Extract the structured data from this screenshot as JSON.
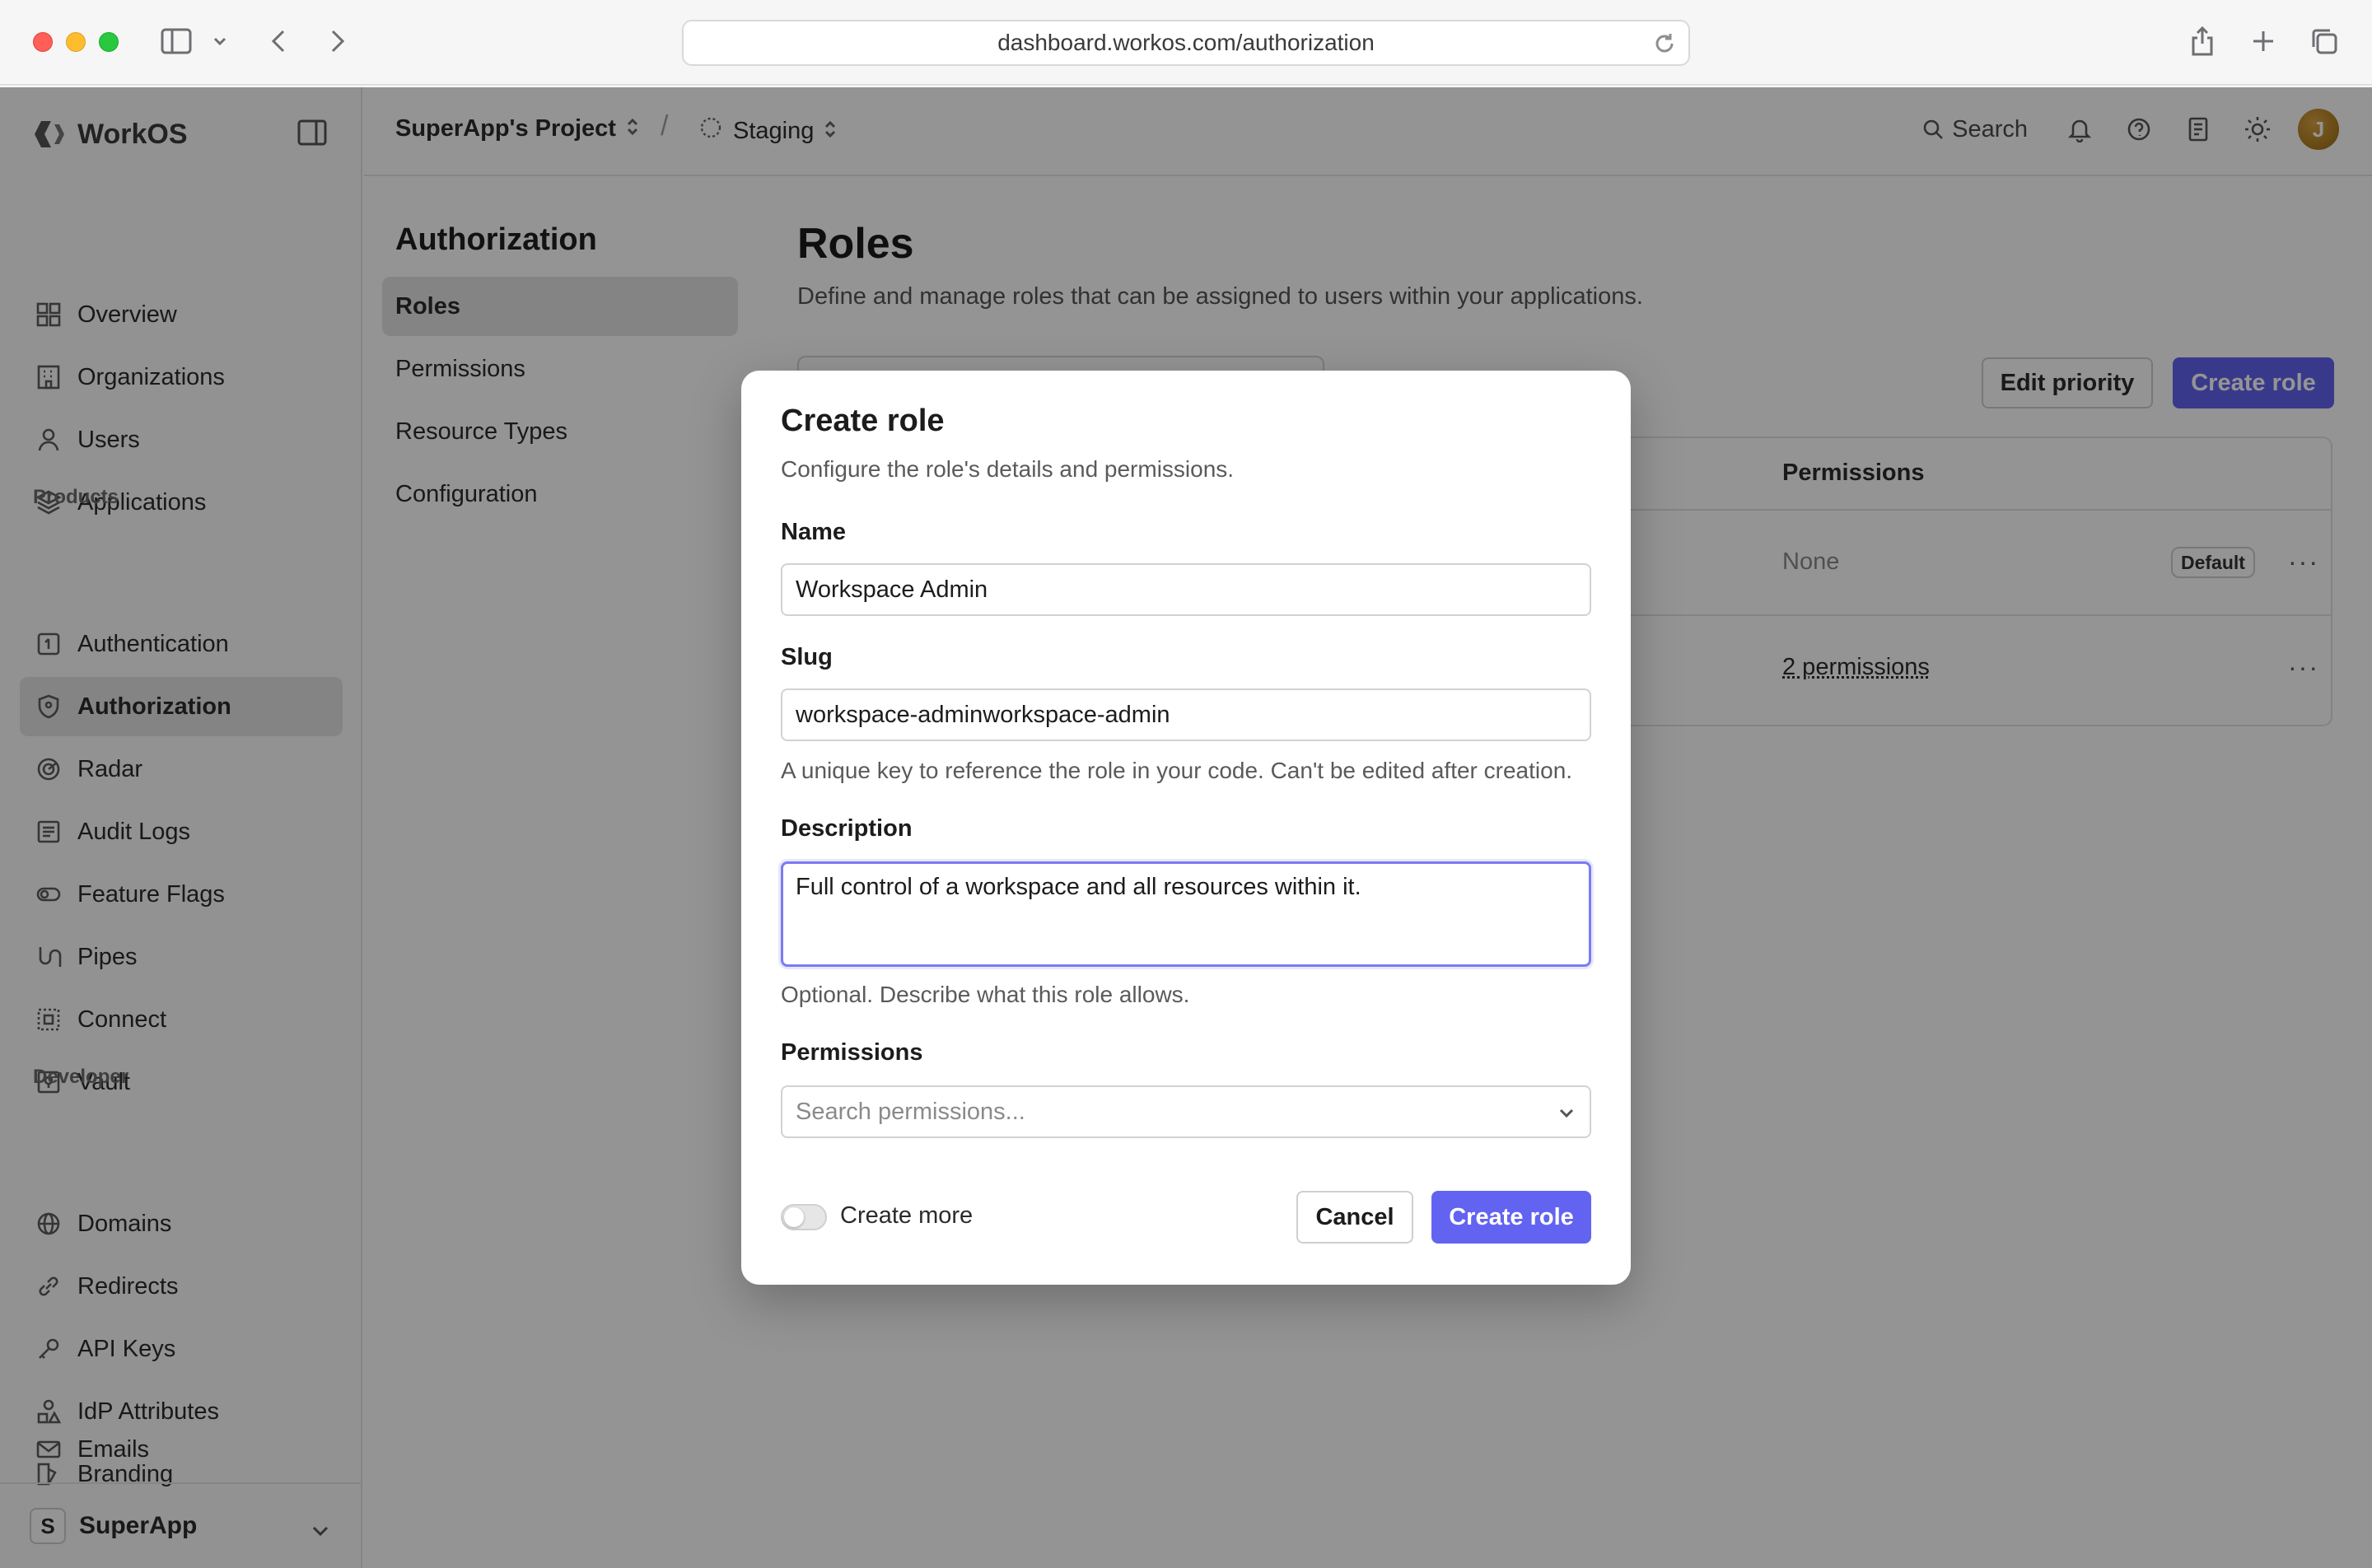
{
  "browser": {
    "url": "dashboard.workos.com/authorization"
  },
  "sidebar": {
    "brand": "WorkOS",
    "items_top": [
      {
        "label": "Overview",
        "icon": "grid-icon"
      },
      {
        "label": "Organizations",
        "icon": "building-icon"
      },
      {
        "label": "Users",
        "icon": "user-icon"
      },
      {
        "label": "Applications",
        "icon": "layers-icon"
      }
    ],
    "products_label": "Products",
    "products": [
      {
        "label": "Authentication",
        "icon": "auth-icon"
      },
      {
        "label": "Authorization",
        "icon": "shield-icon",
        "active": true
      },
      {
        "label": "Radar",
        "icon": "radar-icon"
      },
      {
        "label": "Audit Logs",
        "icon": "audit-icon"
      },
      {
        "label": "Feature Flags",
        "icon": "toggle-icon"
      },
      {
        "label": "Pipes",
        "icon": "pipes-icon"
      },
      {
        "label": "Connect",
        "icon": "connect-icon"
      },
      {
        "label": "Vault",
        "icon": "vault-icon"
      }
    ],
    "developer_label": "Developer",
    "developer": [
      {
        "label": "Domains",
        "icon": "globe-icon"
      },
      {
        "label": "Redirects",
        "icon": "link-icon"
      },
      {
        "label": "API Keys",
        "icon": "key-icon"
      },
      {
        "label": "IdP Attributes",
        "icon": "shapes-icon"
      },
      {
        "label": "Branding",
        "icon": "brush-icon"
      },
      {
        "label": "Emails",
        "icon": "mail-icon"
      }
    ],
    "org": {
      "initial": "S",
      "name": "SuperApp"
    }
  },
  "topbar": {
    "project": "SuperApp's Project",
    "separator": "/",
    "environment": "Staging",
    "search_label": "Search",
    "avatar_initial": "J"
  },
  "subnav": {
    "title": "Authorization",
    "items": [
      "Roles",
      "Permissions",
      "Resource Types",
      "Configuration"
    ]
  },
  "page": {
    "title": "Roles",
    "description": "Define and manage roles that can be assigned to users within your applications.",
    "edit_priority": "Edit priority",
    "create_role": "Create role",
    "table": {
      "permissions_header": "Permissions",
      "rows": [
        {
          "permissions": "None",
          "badge": "Default",
          "more": "···"
        },
        {
          "permissions": "2 permissions",
          "more": "···"
        }
      ]
    }
  },
  "modal": {
    "title": "Create role",
    "subtitle": "Configure the role's details and permissions.",
    "name_label": "Name",
    "name_value": "Workspace Admin",
    "slug_label": "Slug",
    "slug_value": "workspace-adminworkspace-admin",
    "slug_help": "A unique key to reference the role in your code. Can't be edited after creation.",
    "description_label": "Description",
    "description_value": "Full control of a workspace and all resources within it.",
    "description_help": "Optional. Describe what this role allows.",
    "permissions_label": "Permissions",
    "permissions_placeholder": "Search permissions...",
    "create_more_label": "Create more",
    "create_more_on": false,
    "cancel_label": "Cancel",
    "submit_label": "Create role"
  },
  "colors": {
    "accent": "#6363f1",
    "focus_ring": "#7b7bf0"
  }
}
